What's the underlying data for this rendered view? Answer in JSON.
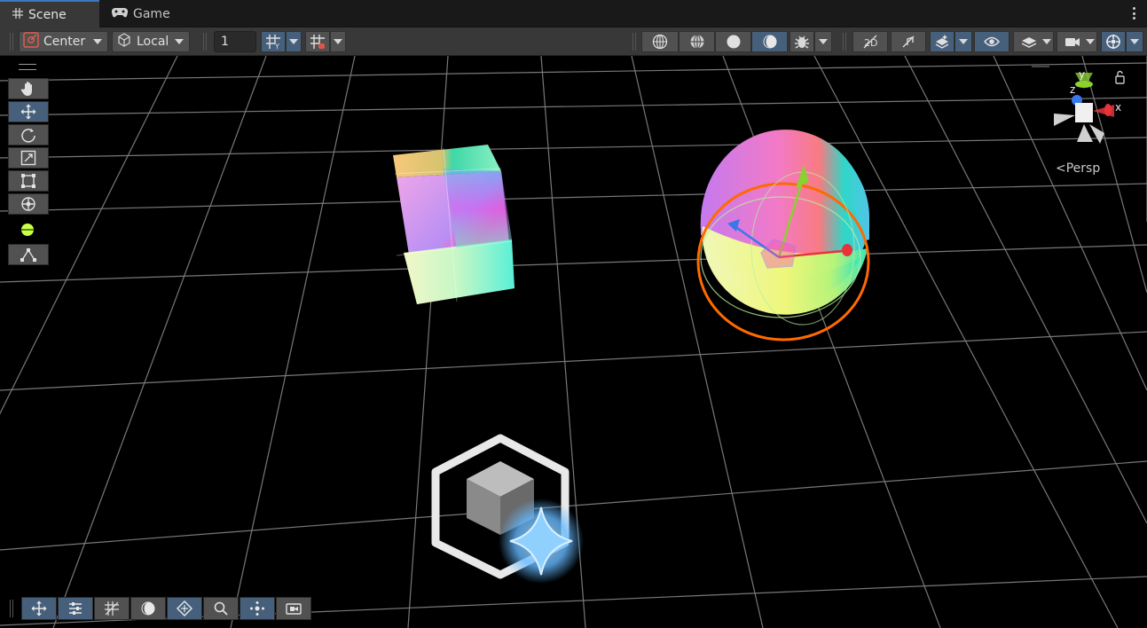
{
  "tabs": [
    {
      "label": "Scene",
      "icon": "hash-grid-icon",
      "active": true
    },
    {
      "label": "Game",
      "icon": "gamepad-icon",
      "active": false
    }
  ],
  "toolbar": {
    "pivot_mode": "Center",
    "pivot_rotation": "Local",
    "grid_increment": "1",
    "toggles": [
      {
        "name": "wireframe-shading-icon",
        "active": false
      },
      {
        "name": "shaded-wireframe-icon",
        "active": false
      },
      {
        "name": "shaded-icon",
        "active": false
      },
      {
        "name": "unlit-icon",
        "active": true
      },
      {
        "name": "debug-bug-icon",
        "active": false
      },
      {
        "name": "2d-toggle-icon",
        "active": false
      },
      {
        "name": "audio-mute-icon",
        "active": false
      },
      {
        "name": "effects-icon",
        "active": true
      },
      {
        "name": "visibility-eye-icon",
        "active": true
      },
      {
        "name": "layers-icon",
        "active": false
      },
      {
        "name": "camera-icon",
        "active": false
      },
      {
        "name": "gizmos-icon",
        "active": true
      }
    ]
  },
  "left_tools": [
    {
      "name": "hand-tool",
      "active": false
    },
    {
      "name": "move-tool",
      "active": true
    },
    {
      "name": "rotate-tool",
      "active": false
    },
    {
      "name": "scale-tool",
      "active": false
    },
    {
      "name": "rect-tool",
      "active": false
    },
    {
      "name": "transform-tool",
      "active": false
    },
    {
      "name": "custom-tool",
      "active": false
    },
    {
      "name": "path-tool",
      "active": false
    }
  ],
  "bottom_tools": [
    {
      "name": "move-overlay-icon",
      "active": true
    },
    {
      "name": "tool-settings-icon",
      "active": true
    },
    {
      "name": "grid-snapping-icon",
      "active": false
    },
    {
      "name": "light-probe-icon",
      "active": false
    },
    {
      "name": "navmesh-icon",
      "active": true
    },
    {
      "name": "search-icon",
      "active": false
    },
    {
      "name": "particle-icon",
      "active": true
    },
    {
      "name": "camera-preview-icon",
      "active": false
    }
  ],
  "gizmo": {
    "projection_label": "Persp",
    "axis_x": "x",
    "axis_y": "y",
    "axis_z": "z"
  },
  "colors": {
    "tab_active": "#383838",
    "toolbar": "#383838",
    "button": "#515151",
    "button_active": "#46607c",
    "selection_outline": "#ff6a00",
    "axis_x": "#e8333b",
    "axis_y": "#8ad131",
    "axis_z": "#3a77e8"
  }
}
